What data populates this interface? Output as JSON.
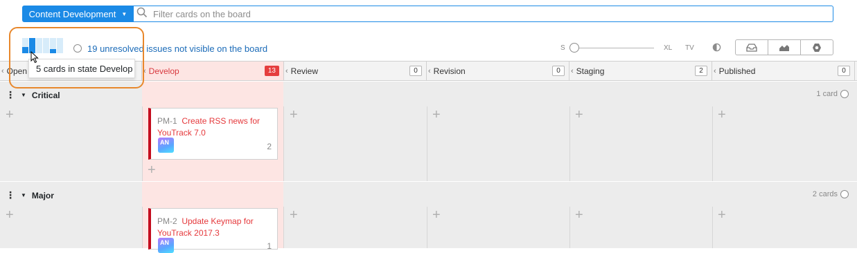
{
  "board": {
    "name": "Content Development"
  },
  "search": {
    "placeholder": "Filter cards on the board"
  },
  "overview": {
    "tooltip": "5 cards in state Develop",
    "unresolved_text": "19 unresolved issues not visible on the board",
    "mini_fill_levels": [
      0.4,
      1.0,
      0,
      0,
      0.25,
      0
    ]
  },
  "size": {
    "s": "S",
    "xl": "XL",
    "tv": "TV"
  },
  "icons": {
    "search": "search-icon",
    "contrast": "contrast-icon",
    "view": [
      "inbox-icon",
      "chart-icon",
      "settings-icon"
    ]
  },
  "colors": {
    "accent": "#1b8ae6",
    "develop_bg": "#fde5e3",
    "develop_count": "#e53e3e",
    "card_bar": "#c40d1e",
    "summary": "#e5383b"
  },
  "columns": [
    {
      "name": "Open",
      "count": ""
    },
    {
      "name": "Develop",
      "count": "13"
    },
    {
      "name": "Review",
      "count": "0"
    },
    {
      "name": "Revision",
      "count": "0"
    },
    {
      "name": "Staging",
      "count": "2"
    },
    {
      "name": "Published",
      "count": "0"
    }
  ],
  "swimlanes": [
    {
      "title": "Critical",
      "count_label": "1 card",
      "card": {
        "id": "PM-1",
        "summary": "Create RSS news for YouTrack 7.0",
        "avatar": "AN",
        "points": "2"
      }
    },
    {
      "title": "Major",
      "count_label": "2 cards",
      "card": {
        "id": "PM-2",
        "summary": "Update Keymap for YouTrack 2017.3",
        "avatar": "AN",
        "points": "1"
      }
    }
  ]
}
